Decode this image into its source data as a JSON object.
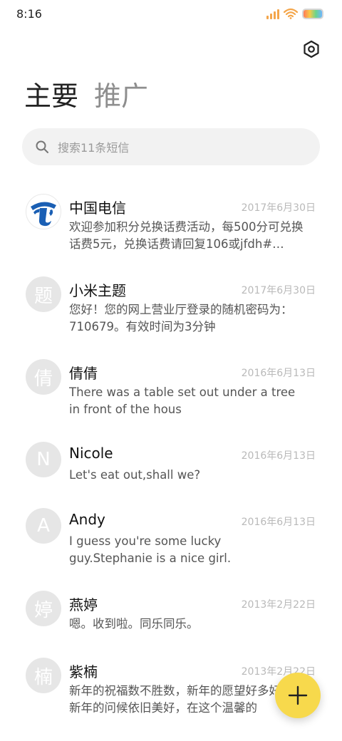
{
  "status_bar": {
    "time": "8:16",
    "signal_color": "#f4a64b",
    "wifi_color": "#f4a64b"
  },
  "header": {
    "settings_icon": "hexagon-settings-icon",
    "tabs": [
      {
        "label": "主要",
        "active": true
      },
      {
        "label": "推广",
        "active": false
      }
    ]
  },
  "search": {
    "placeholder": "搜索11条短信",
    "icon": "search-icon"
  },
  "conversations": [
    {
      "avatar": "",
      "avatar_type": "china-telecom-logo-icon",
      "name": "中国电信",
      "date": "2017年6月30日",
      "preview": "欢迎参加积分兑换话费活动，每500分可兑换话费5元，兑换话费请回复106或jfdh#…"
    },
    {
      "avatar": "题",
      "name": "小米主题",
      "date": "2017年6月30日",
      "preview": "您好！您的网上营业厅登录的随机密码为：710679。有效时间为3分钟"
    },
    {
      "avatar": "倩",
      "name": "倩倩",
      "date": "2016年6月13日",
      "preview": "There was a table set out under a tree in front of the hous"
    },
    {
      "avatar": "N",
      "name": "Nicole",
      "date": "2016年6月13日",
      "preview": "Let's eat out,shall we?"
    },
    {
      "avatar": "A",
      "name": "Andy",
      "date": "2016年6月13日",
      "preview": "I guess you're some lucky guy.Stephanie is a nice girl."
    },
    {
      "avatar": "婷",
      "name": "燕婷",
      "date": "2013年2月22日",
      "preview": "嗯。收到啦。同乐同乐。"
    },
    {
      "avatar": "楠",
      "name": "紫楠",
      "date": "2013年2月22日",
      "preview": "新年的祝福数不胜数，新年的愿望好多好多，新年的问候依旧美好，在这个温馨的"
    }
  ],
  "fab": {
    "icon": "plus-icon",
    "color": "#f7d94c"
  },
  "colors": {
    "accent": "#f7d94c",
    "telecom_blue": "#1a5fb4",
    "avatar_bg": "#e6e6e6",
    "date_text": "#b9b9b9"
  }
}
